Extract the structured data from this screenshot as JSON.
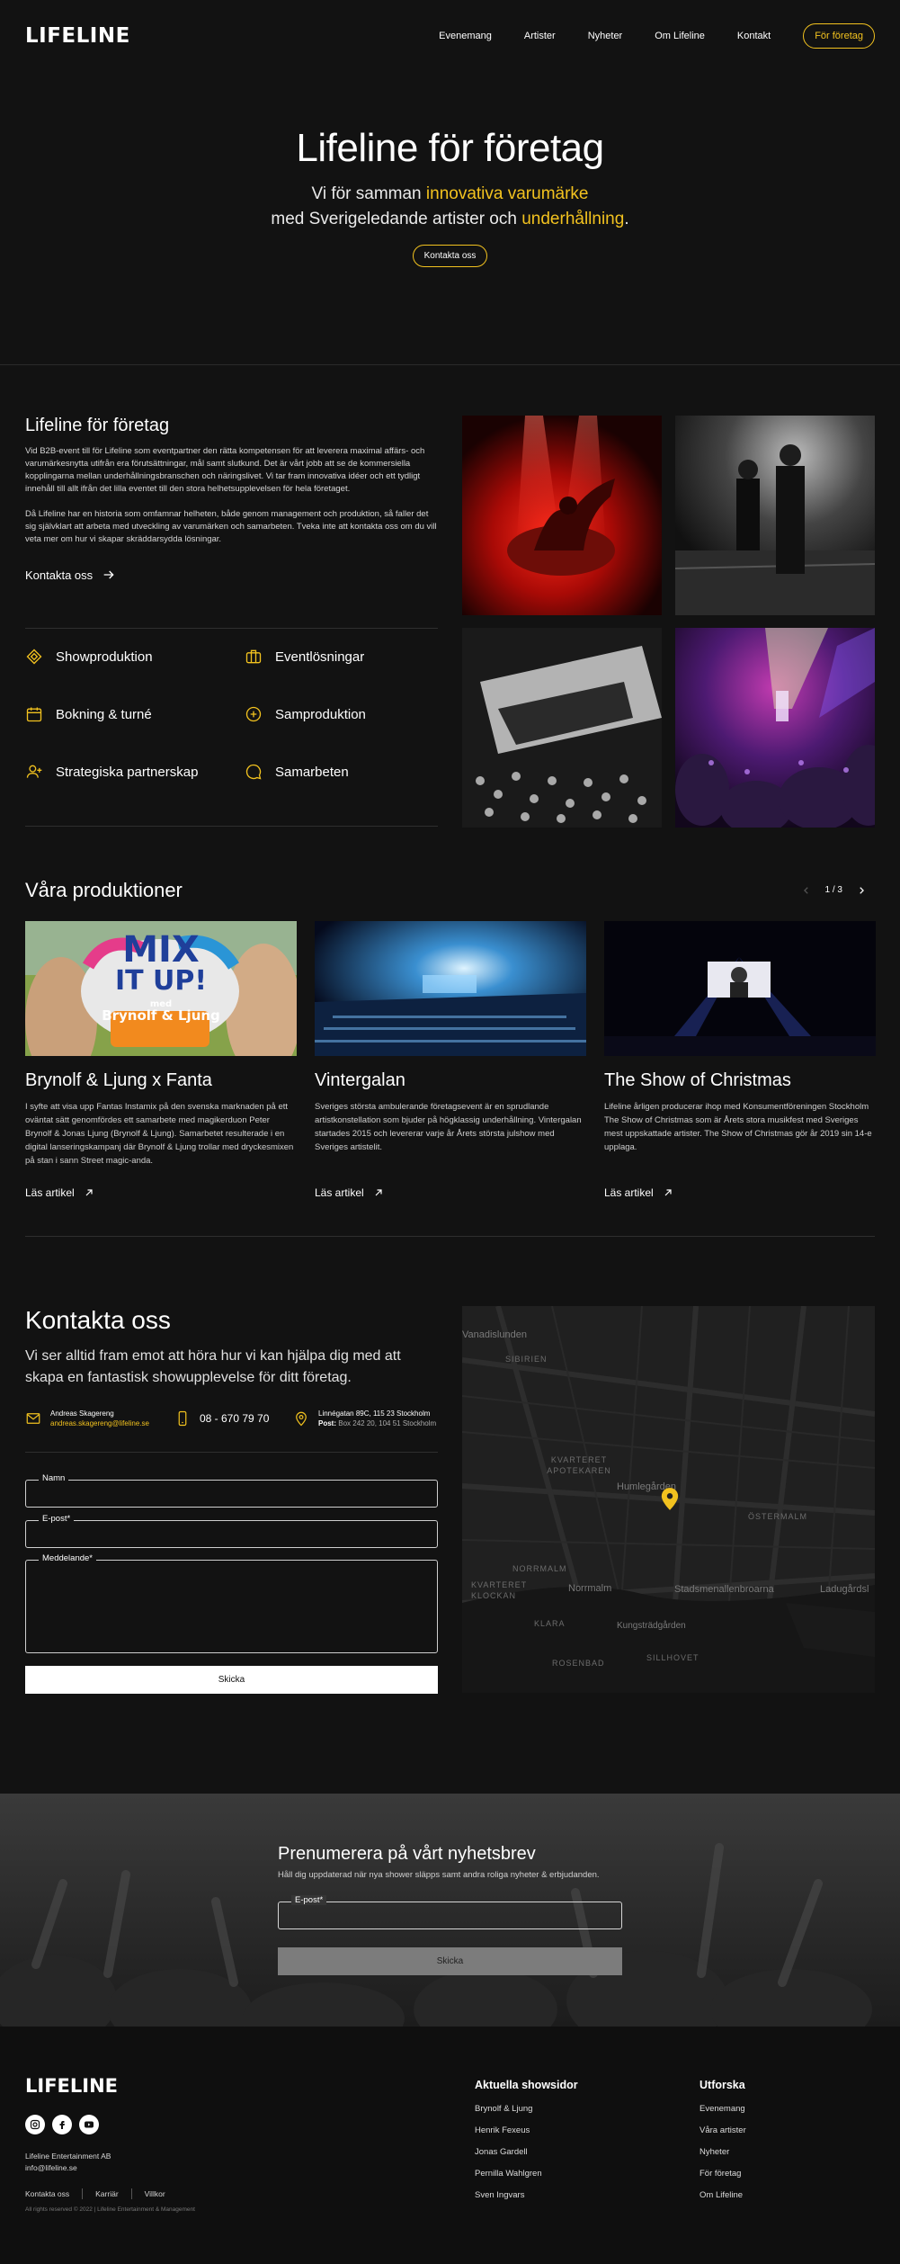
{
  "nav": {
    "logo": "LIFELINE",
    "links": [
      "Evenemang",
      "Artister",
      "Nyheter",
      "Om Lifeline",
      "Kontakt"
    ],
    "cta": "För företag"
  },
  "hero": {
    "title": "Lifeline för företag",
    "line1_pre": "Vi för samman ",
    "line1_hl": "innovativa varumärke",
    "line2_pre": "med Sverigeledande artister och ",
    "line2_hl": "underhållning",
    "line2_post": ".",
    "button": "Kontakta oss"
  },
  "about": {
    "title": "Lifeline för företag",
    "p1": "Vid B2B-event till för Lifeline som eventpartner den rätta kompetensen för att leverera maximal affärs- och varumärkesnytta utifrån era förutsättningar, mål samt slutkund. Det är vårt jobb att se de kommersiella kopplingarna mellan underhållningsbranschen och näringslivet. Vi tar fram innovativa idéer och ett tydligt innehåll till allt ifrån det lilla eventet till den stora helhetsupplevelsen för hela företaget.",
    "p2": "Då Lifeline har en historia som omfamnar helheten, både genom management och produktion, så faller det sig självklart att arbeta med utveckling av varumärken och samarbeten. Tveka inte att kontakta oss om du vill veta mer om hur vi skapar skräddarsydda lösningar.",
    "link": "Kontakta oss",
    "services": [
      "Showproduktion",
      "Eventlösningar",
      "Bokning & turné",
      "Samproduktion",
      "Strategiska partnerskap",
      "Samarbeten"
    ]
  },
  "productions": {
    "title": "Våra produktioner",
    "pager": "1 / 3",
    "read_more": "Läs artikel",
    "cards": [
      {
        "title": "Brynolf & Ljung x Fanta",
        "text": "I syfte att visa upp Fantas Instamix på den svenska marknaden på ett oväntat sätt genomfördes ett samarbete med magikerduon Peter Brynolf & Jonas Ljung (Brynolf & Ljung). Samarbetet resulterade i en digital lanseringskampanj där Brynolf & Ljung trollar med dryckesmixen på stan i sann Street magic-anda.",
        "img_text1": "MIX",
        "img_text2": "IT UP!",
        "img_text3": "med",
        "img_text4": "Brynolf & Ljung"
      },
      {
        "title": "Vintergalan",
        "text": "Sveriges största ambulerande företagsevent är en sprudlande artistkonstellation som bjuder på högklassig underhållning. Vintergalan startades 2015 och levererar varje år Årets största julshow med Sveriges artistelit."
      },
      {
        "title": "The Show of Christmas",
        "text": "Lifeline årligen producerar ihop med Konsumentföreningen Stockholm The Show of Christmas som är Årets stora musikfest med Sveriges mest uppskattade artister. The Show of Christmas gör år 2019 sin 14-e upplaga."
      }
    ]
  },
  "contact": {
    "title": "Kontakta oss",
    "lead": "Vi ser alltid fram emot att höra hur vi kan hjälpa dig med att skapa en fantastisk showupplevelse för ditt företag.",
    "person_name": "Andreas Skagereng",
    "person_email": "andreas.skagereng@lifeline.se",
    "phone": "08 - 670 79 70",
    "address1": "Linnégatan 89C, 115 23 Stockholm",
    "address2_label": "Post:",
    "address2": "Box 242 20, 104 51 Stockholm",
    "fields": {
      "name": "Namn",
      "email": "E-post*",
      "message": "Meddelande*"
    },
    "submit": "Skicka"
  },
  "map": {
    "areas": [
      "SIBIRIEN",
      "KVARTERET APOTEKAREN",
      "ÖSTERMALM",
      "NORRMALM",
      "KVARTERET KLOCKAN",
      "KLARA",
      "ROSENBAD",
      "SILLHOVET"
    ],
    "streets": [
      "Vanadislunden",
      "Humlegården",
      "Norrmalm",
      "Stadsmenallenbroarna",
      "Ladugårdsl",
      "Kungsträdgården"
    ],
    "pin_color": "#f2c21f"
  },
  "newsletter": {
    "title": "Prenumerera på vårt nyhetsbrev",
    "sub": "Håll dig uppdaterad när nya shower släpps samt andra roliga nyheter & erbjudanden.",
    "field": "E-post*",
    "submit": "Skicka"
  },
  "footer": {
    "logo": "LIFELINE",
    "company": "Lifeline Entertainment AB",
    "email": "info@lifeline.se",
    "legal": [
      "Kontakta oss",
      "Karriär",
      "Villkor"
    ],
    "copyright": "All rights reserved © 2022 | Lifeline Entertainment & Management",
    "col1_title": "Aktuella showsidor",
    "col1": [
      "Brynolf & Ljung",
      "Henrik Fexeus",
      "Jonas Gardell",
      "Pernilla Wahlgren",
      "Sven Ingvars"
    ],
    "col2_title": "Utforska",
    "col2": [
      "Evenemang",
      "Våra artister",
      "Nyheter",
      "För företag",
      "Om Lifeline"
    ]
  },
  "colors": {
    "accent": "#f2c21f",
    "background": "#121212"
  }
}
